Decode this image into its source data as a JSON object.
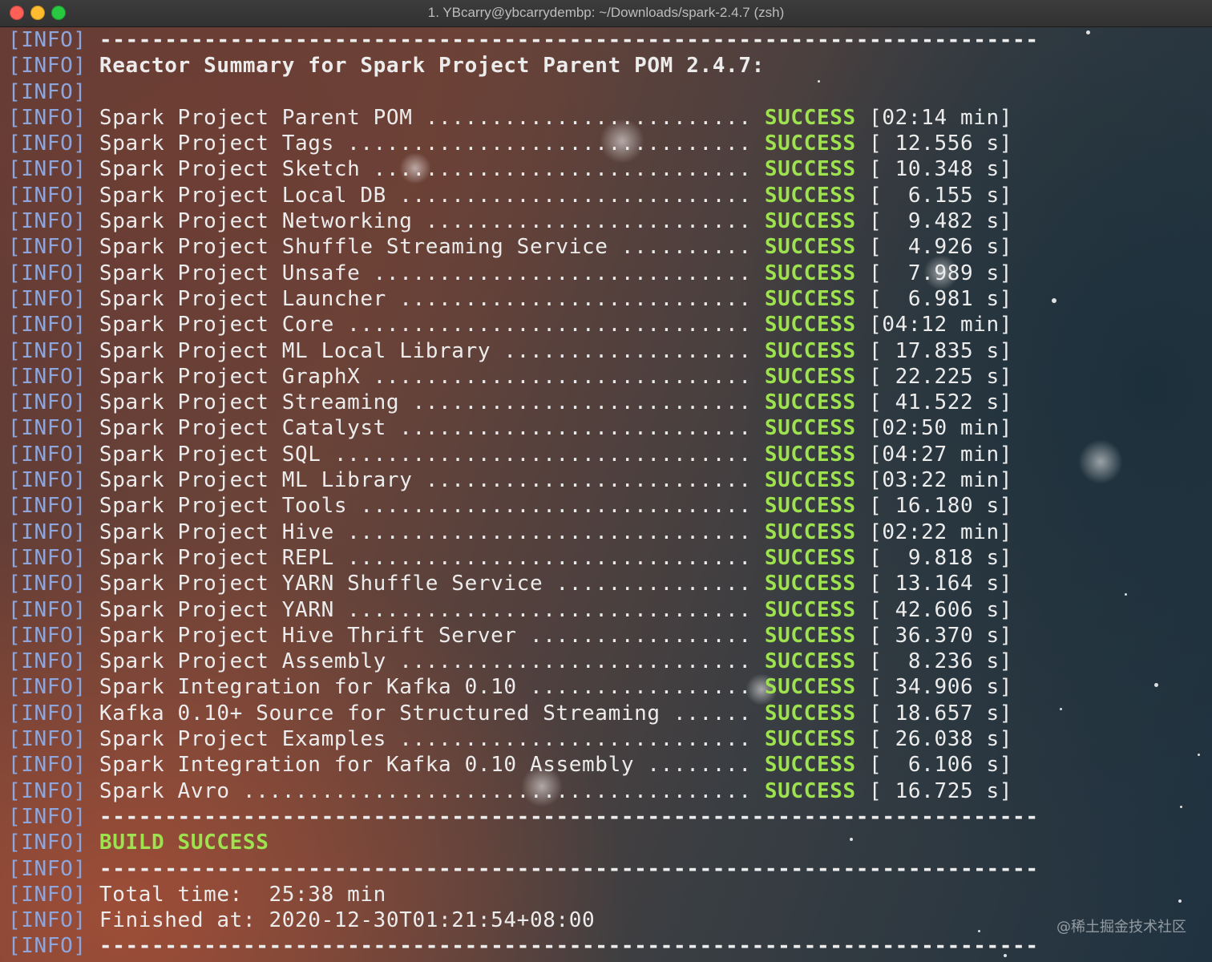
{
  "window": {
    "title": "1. YBcarry@ybcarrydembp: ~/Downloads/spark-2.4.7 (zsh)"
  },
  "colors": {
    "info_tag": "#8ea6dc",
    "success": "#9ee24f",
    "text": "#ececec"
  },
  "terminal": {
    "prefix": "[INFO]",
    "separator": "------------------------------------------------------------------------",
    "reactor_title": "Reactor Summary for Spark Project Parent POM 2.4.7:",
    "success_label": "SUCCESS",
    "modules": [
      {
        "name": "Spark Project Parent POM",
        "time": "[02:14 min]"
      },
      {
        "name": "Spark Project Tags",
        "time": "[ 12.556 s]"
      },
      {
        "name": "Spark Project Sketch",
        "time": "[ 10.348 s]"
      },
      {
        "name": "Spark Project Local DB",
        "time": "[  6.155 s]"
      },
      {
        "name": "Spark Project Networking",
        "time": "[  9.482 s]"
      },
      {
        "name": "Spark Project Shuffle Streaming Service",
        "time": "[  4.926 s]"
      },
      {
        "name": "Spark Project Unsafe",
        "time": "[  7.989 s]"
      },
      {
        "name": "Spark Project Launcher",
        "time": "[  6.981 s]"
      },
      {
        "name": "Spark Project Core",
        "time": "[04:12 min]"
      },
      {
        "name": "Spark Project ML Local Library",
        "time": "[ 17.835 s]"
      },
      {
        "name": "Spark Project GraphX",
        "time": "[ 22.225 s]"
      },
      {
        "name": "Spark Project Streaming",
        "time": "[ 41.522 s]"
      },
      {
        "name": "Spark Project Catalyst",
        "time": "[02:50 min]"
      },
      {
        "name": "Spark Project SQL",
        "time": "[04:27 min]"
      },
      {
        "name": "Spark Project ML Library",
        "time": "[03:22 min]"
      },
      {
        "name": "Spark Project Tools",
        "time": "[ 16.180 s]"
      },
      {
        "name": "Spark Project Hive",
        "time": "[02:22 min]"
      },
      {
        "name": "Spark Project REPL",
        "time": "[  9.818 s]"
      },
      {
        "name": "Spark Project YARN Shuffle Service",
        "time": "[ 13.164 s]"
      },
      {
        "name": "Spark Project YARN",
        "time": "[ 42.606 s]"
      },
      {
        "name": "Spark Project Hive Thrift Server",
        "time": "[ 36.370 s]"
      },
      {
        "name": "Spark Project Assembly",
        "time": "[  8.236 s]"
      },
      {
        "name": "Spark Integration for Kafka 0.10",
        "time": "[ 34.906 s]"
      },
      {
        "name": "Kafka 0.10+ Source for Structured Streaming",
        "time": "[ 18.657 s]"
      },
      {
        "name": "Spark Project Examples",
        "time": "[ 26.038 s]"
      },
      {
        "name": "Spark Integration for Kafka 0.10 Assembly",
        "time": "[  6.106 s]"
      },
      {
        "name": "Spark Avro",
        "time": "[ 16.725 s]"
      }
    ],
    "build_result": "BUILD SUCCESS",
    "total_time": "Total time:  25:38 min",
    "finished_at": "Finished at: 2020-12-30T01:21:54+08:00"
  },
  "watermark": "@稀土掘金技术社区"
}
